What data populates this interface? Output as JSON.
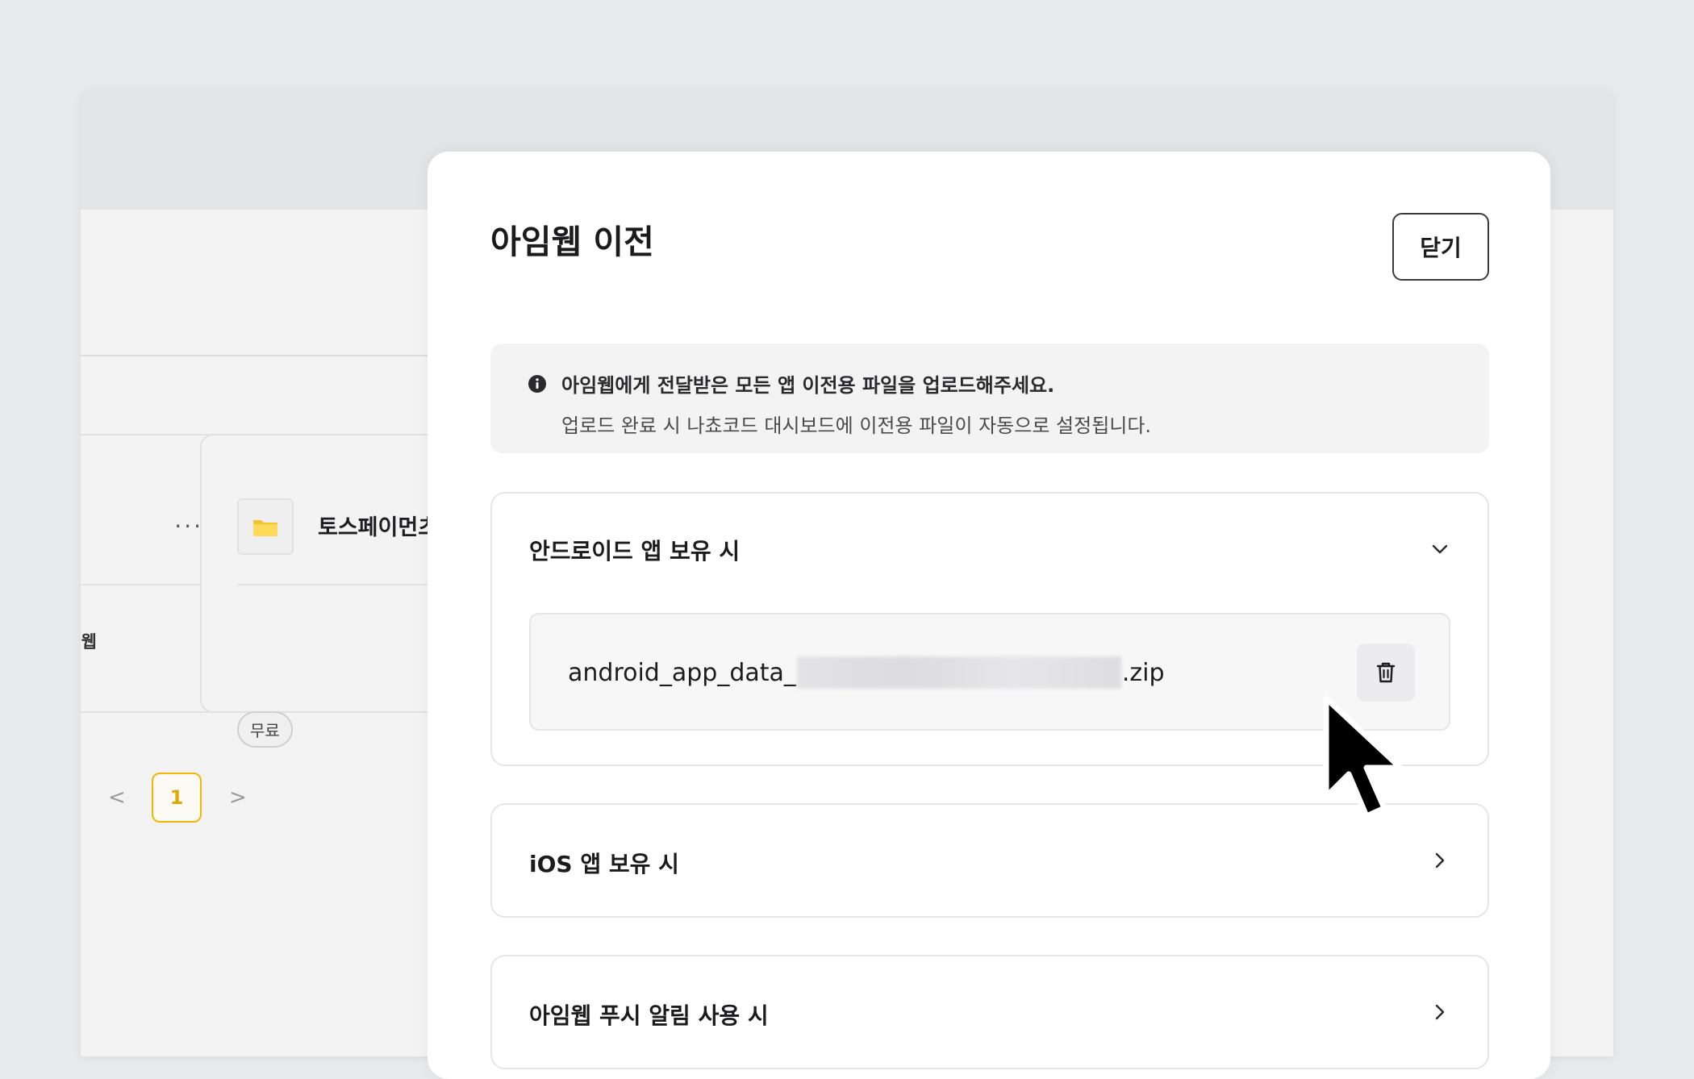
{
  "background": {
    "card_more": "···",
    "card_author": "아임웹",
    "card_name": "토스페이먼츠",
    "price_chip": "무료",
    "pager": {
      "prev": "<",
      "current": "1",
      "next": ">"
    }
  },
  "modal": {
    "title": "아임웹 이전",
    "close_label": "닫기",
    "notice": {
      "icon": "info-icon",
      "line1": "아임웹에게 전달받은 모든 앱 이전용 파일을 업로드해주세요.",
      "line2": "업로드 완료 시 나쵸코드 대시보드에 이전용 파일이 자동으로 설정됩니다."
    },
    "sections": [
      {
        "title": "안드로이드 앱 보유 시",
        "expanded": true,
        "file": {
          "prefix": "android_app_data_",
          "suffix": ".zip"
        }
      },
      {
        "title": "iOS 앱 보유 시",
        "expanded": false
      },
      {
        "title": "아임웹 푸시 알림 사용 시",
        "expanded": false
      }
    ]
  },
  "colors": {
    "accent": "#f2b705",
    "panel": "#ffffff",
    "backdrop": "#e8e9eb"
  }
}
